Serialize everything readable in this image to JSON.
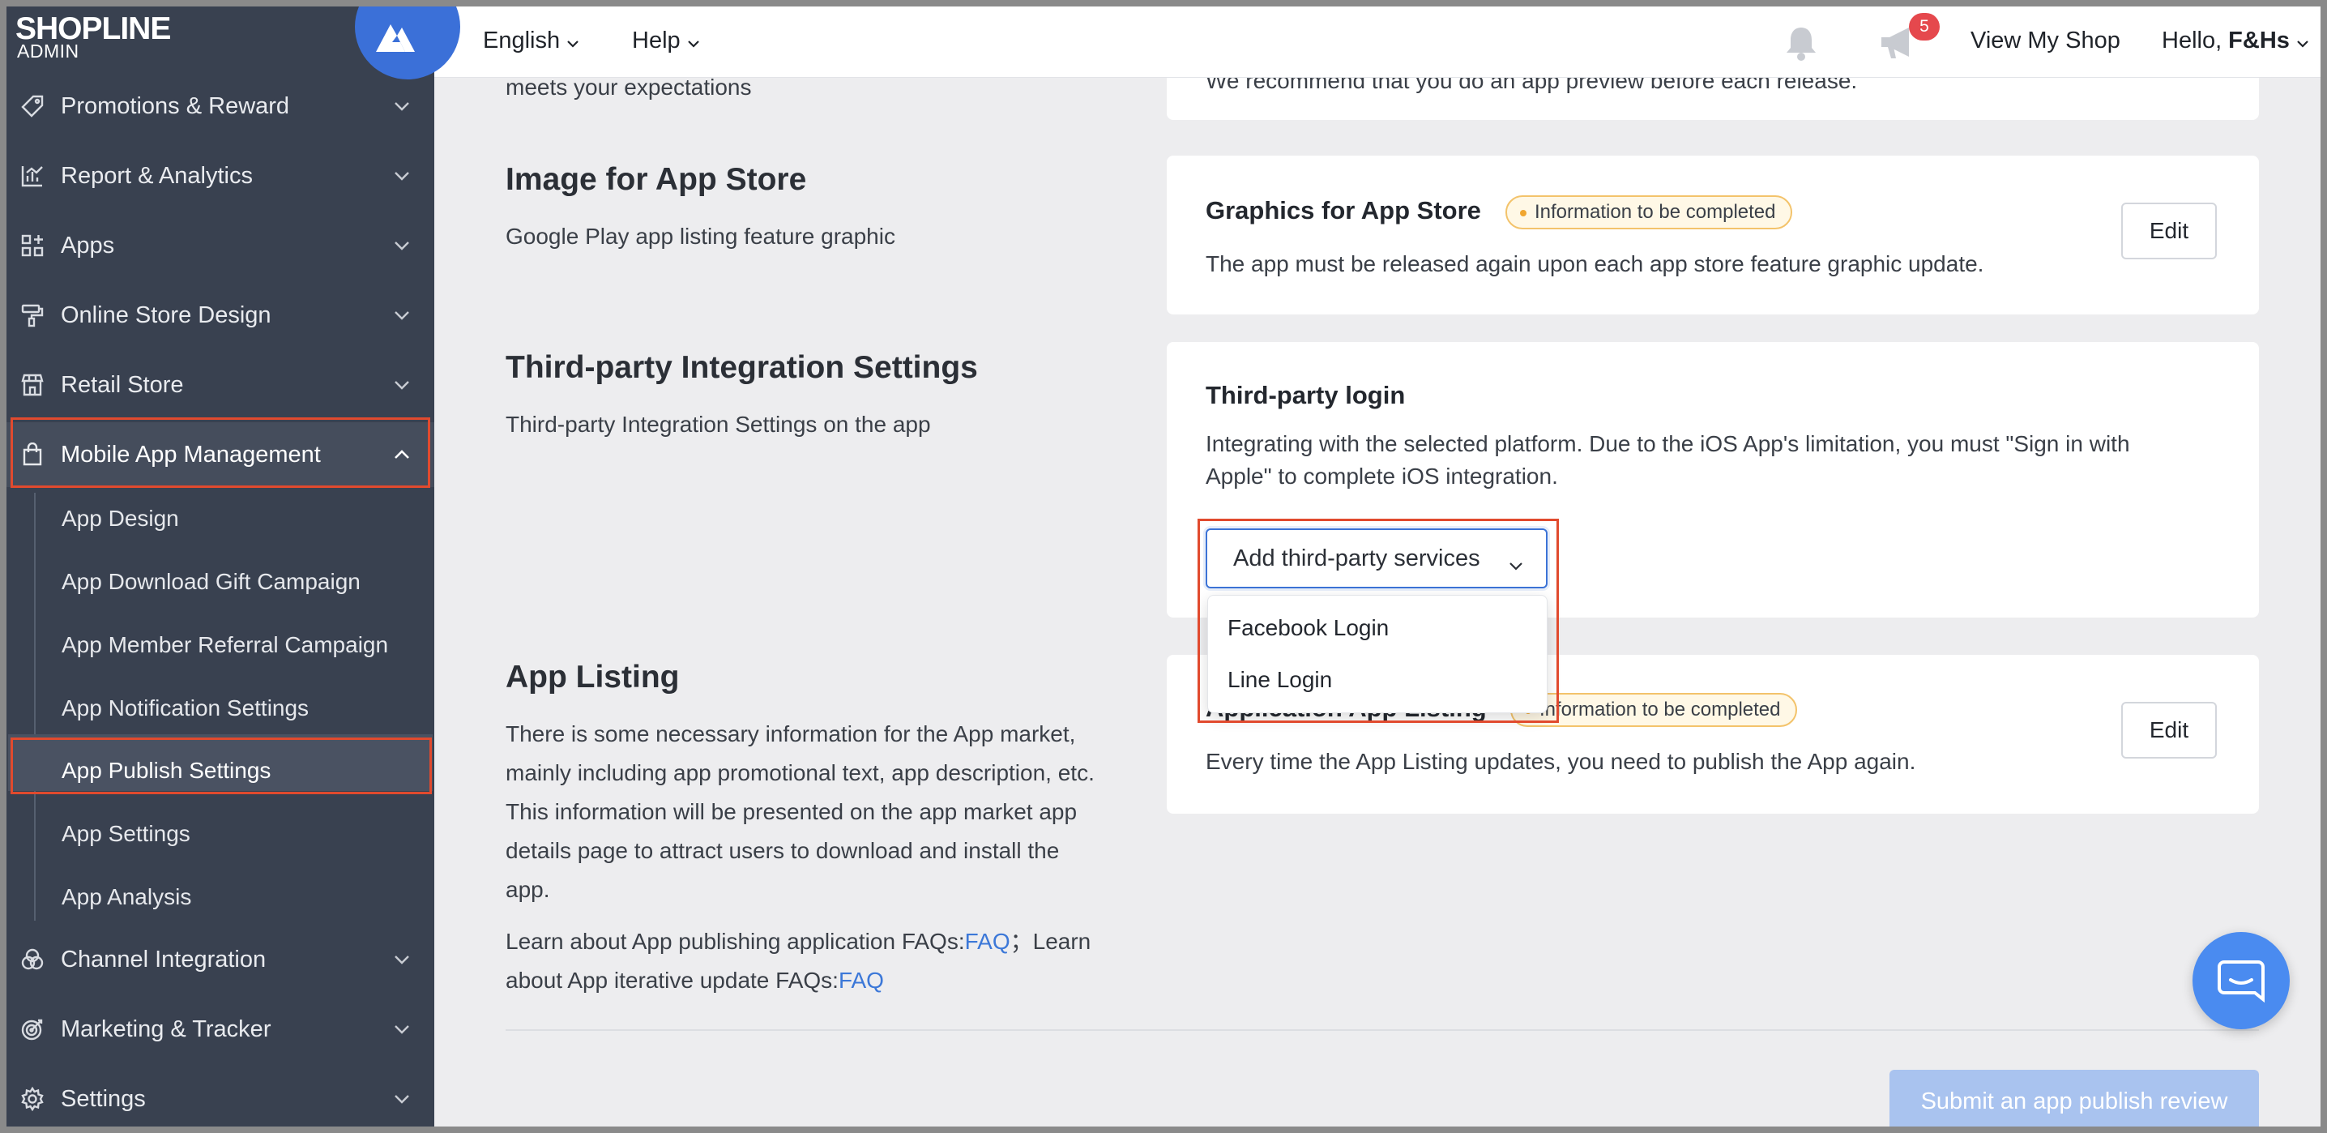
{
  "brand": {
    "logo_text": "SHOPLINE",
    "logo_sub": "ADMIN"
  },
  "sidebar": {
    "items": [
      {
        "label": "Promotions & Reward",
        "icon": "tag-icon"
      },
      {
        "label": "Report & Analytics",
        "icon": "chart-icon"
      },
      {
        "label": "Apps",
        "icon": "apps-grid-icon"
      },
      {
        "label": "Online Store Design",
        "icon": "paint-roller-icon"
      },
      {
        "label": "Retail Store",
        "icon": "store-icon"
      },
      {
        "label": "Mobile App Management",
        "icon": "shopping-bag-icon",
        "expanded": true
      },
      {
        "label": "Channel Integration",
        "icon": "channels-icon"
      },
      {
        "label": "Marketing & Tracker",
        "icon": "target-icon"
      },
      {
        "label": "Settings",
        "icon": "gear-icon"
      }
    ],
    "submenu": [
      "App Design",
      "App Download Gift Campaign",
      "App Member Referral Campaign",
      "App Notification Settings",
      "App Publish Settings",
      "App Settings",
      "App Analysis"
    ],
    "active_submenu": "App Publish Settings"
  },
  "topbar": {
    "language": "English",
    "help": "Help",
    "notification_count": "5",
    "view_shop": "View My Shop",
    "greeting": "Hello,",
    "user": "F&Hs"
  },
  "content": {
    "top_left_fragment": "meets your expectations",
    "top_right_fragment": "We recommend that you do an app preview before each release.",
    "image_section": {
      "title": "Image for App Store",
      "desc": "Google Play app listing feature graphic",
      "card_title": "Graphics for App Store",
      "status": "Information to be completed",
      "card_text": "The app must be released again upon each app store feature graphic update.",
      "edit": "Edit"
    },
    "integration_section": {
      "title": "Third-party Integration Settings",
      "desc": "Third-party Integration Settings on the app",
      "card_title": "Third-party login",
      "card_text_1": "Integrating with the selected platform. Due to the iOS App's limitation, you must \"Sign in with",
      "card_text_2": "Apple\" to complete iOS integration.",
      "add_button": "Add third-party services",
      "dropdown_options": [
        "Facebook Login",
        "Line Login"
      ]
    },
    "listing_section": {
      "title": "App Listing",
      "desc_lines": [
        "There is some necessary information for the App market,",
        "mainly including app promotional text, app description, etc.",
        "This information will be presented on the app market app",
        "details page to attract users to download and install the",
        "app."
      ],
      "faq_line1_prefix": "Learn about App publishing application FAQs:",
      "faq_link": "FAQ",
      "faq_line1_suffix": "；Learn",
      "faq_line2_prefix": "about App iterative update FAQs:",
      "card_title": "Application App Listing",
      "status": "Information to be completed",
      "card_text": "Every time the App Listing updates, you need to publish the App again.",
      "edit": "Edit"
    },
    "submit": "Submit an app publish review"
  },
  "colors": {
    "sidebar_bg": "#394150",
    "accent_blue": "#3c73d6",
    "highlight_red": "#e14a2e",
    "badge_red": "#e5484d",
    "status_orange": "#f0a630"
  }
}
